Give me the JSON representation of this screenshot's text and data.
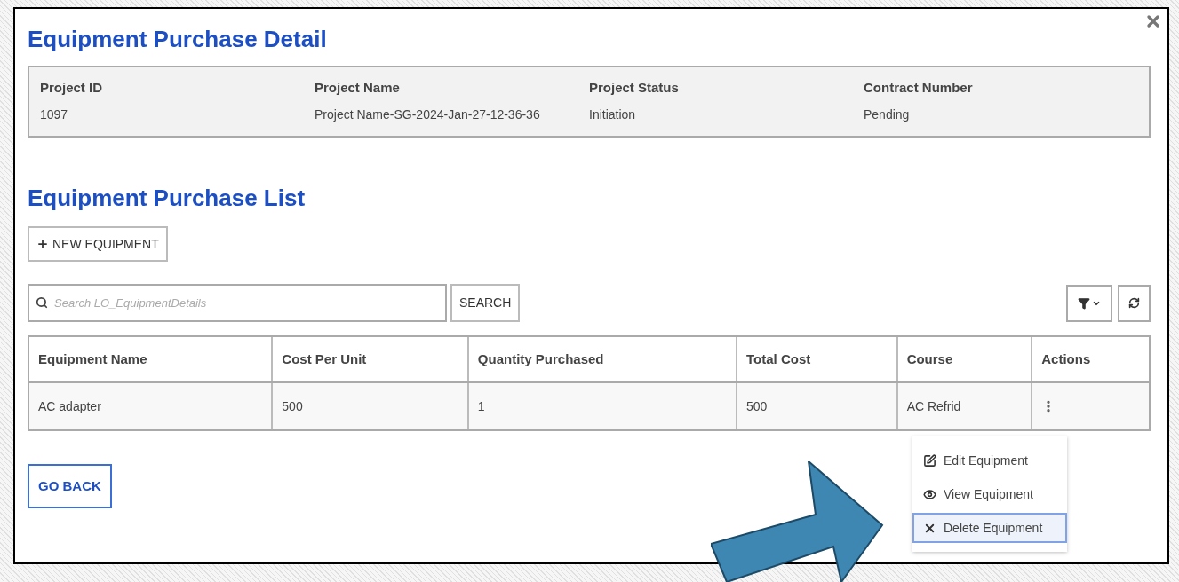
{
  "dialog": {
    "title": "Equipment Purchase Detail"
  },
  "project_info": [
    {
      "label": "Project ID",
      "value": "1097"
    },
    {
      "label": "Project Name",
      "value": "Project Name-SG-2024-Jan-27-12-36-36"
    },
    {
      "label": "Project Status",
      "value": "Initiation"
    },
    {
      "label": "Contract Number",
      "value": "Pending"
    }
  ],
  "list": {
    "title": "Equipment Purchase List",
    "new_button": "NEW EQUIPMENT",
    "search": {
      "placeholder": "Search LO_EquipmentDetails"
    },
    "search_button": "SEARCH"
  },
  "table": {
    "columns": [
      "Equipment Name",
      "Cost Per Unit",
      "Quantity Purchased",
      "Total Cost",
      "Course",
      "Actions"
    ],
    "rows": [
      {
        "cells": [
          "AC adapter",
          "500",
          "1",
          "500",
          "AC Refrid"
        ]
      }
    ]
  },
  "actions_menu": [
    {
      "kind": "edit",
      "label": "Edit Equipment",
      "selected": false
    },
    {
      "kind": "view",
      "label": "View Equipment",
      "selected": false
    },
    {
      "kind": "delete",
      "label": "Delete Equipment",
      "selected": true
    }
  ],
  "back_button": "GO BACK"
}
